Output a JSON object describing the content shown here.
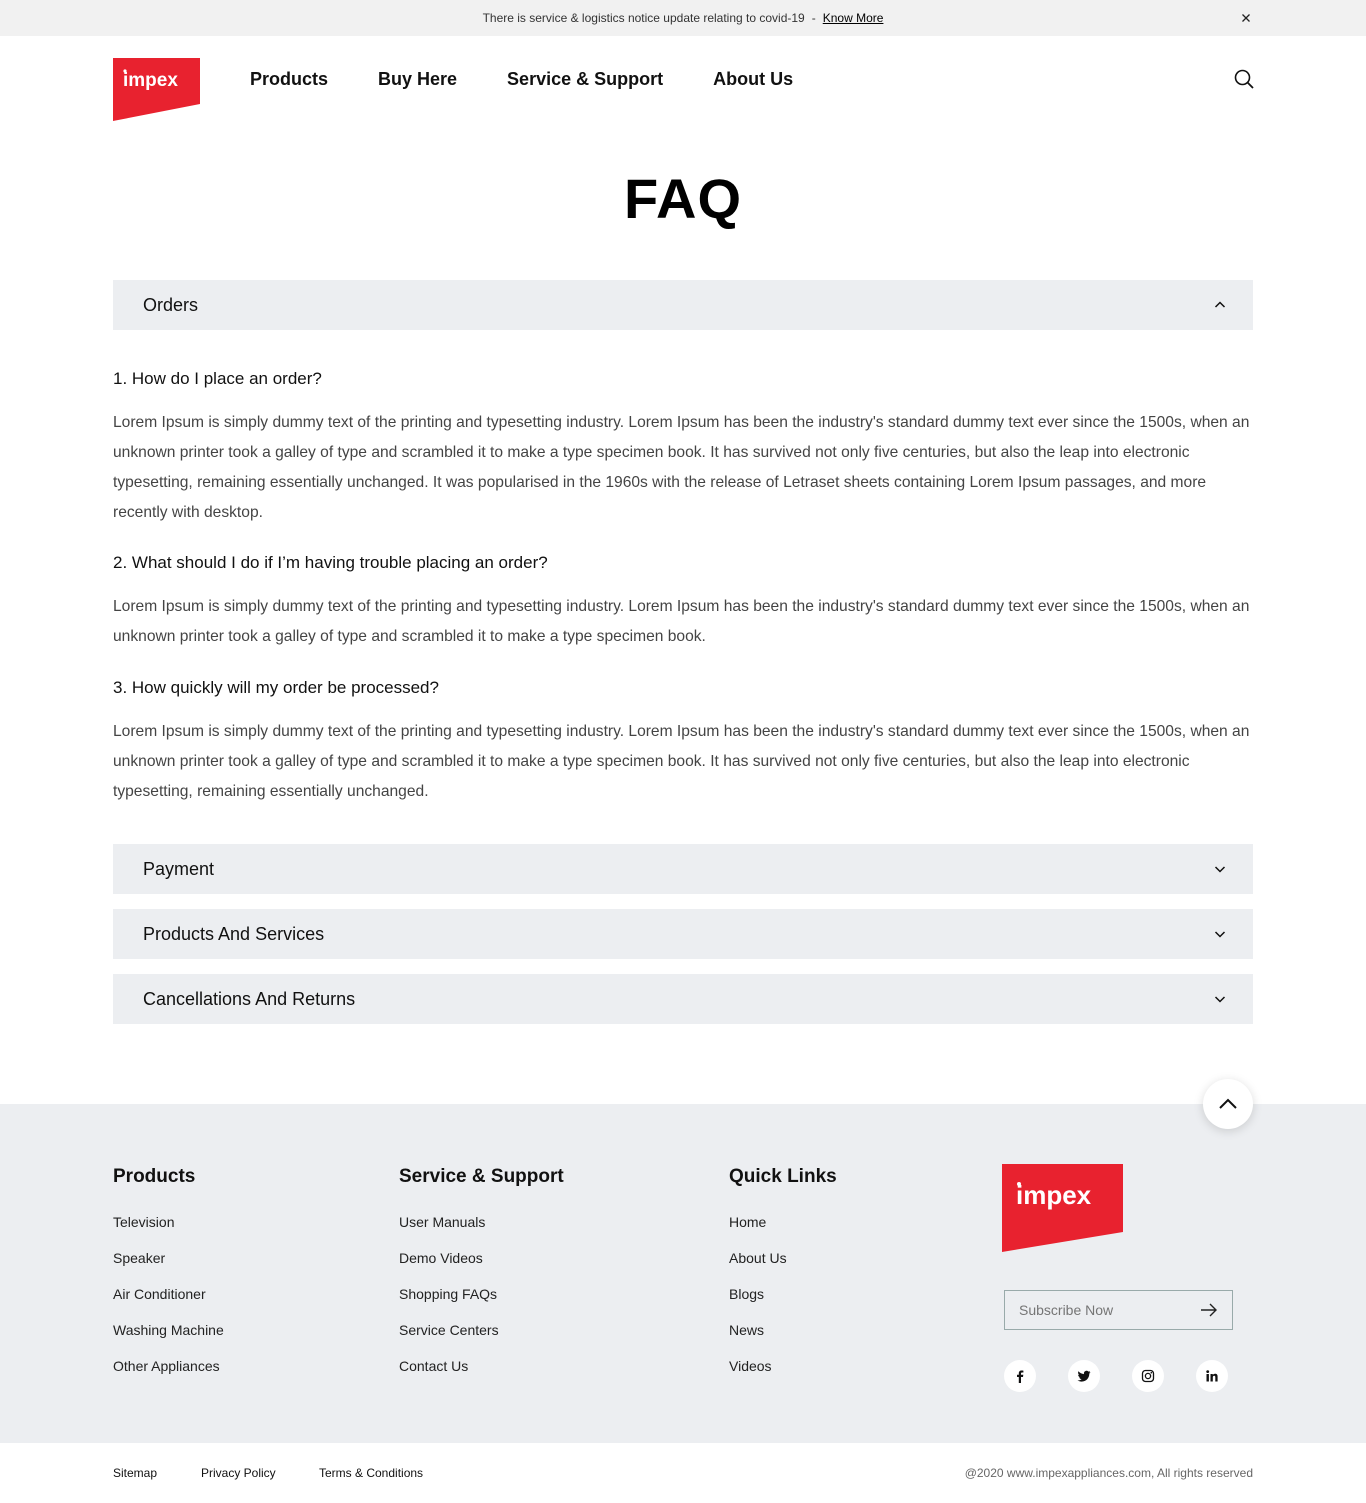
{
  "notice": {
    "text": "There is service & logistics notice update relating to covid-19",
    "separator": "-",
    "link": "Know More",
    "close_icon": "close-icon"
  },
  "header": {
    "logo_text": "impex",
    "nav": [
      "Products",
      "Buy Here",
      "Service & Support",
      "About Us"
    ],
    "search_icon": "search-icon"
  },
  "page": {
    "title": "FAQ"
  },
  "accordion": {
    "open_section": "Orders",
    "items": [
      {
        "q": "1. How do I place an order?",
        "a": "Lorem Ipsum is simply dummy text of the printing and typesetting industry. Lorem Ipsum has been the industry's standard dummy text ever since the 1500s, when an unknown printer took a galley of type and scrambled it to make a type specimen book. It has survived not only five centuries, but also the leap into electronic typesetting, remaining essentially unchanged. It was popularised in the 1960s with the release of Letraset sheets containing Lorem Ipsum passages, and more recently with desktop."
      },
      {
        "q": "2. What should I do if I’m having trouble placing an order?",
        "a": "Lorem Ipsum is simply dummy text of the printing and typesetting industry. Lorem Ipsum has been the industry's standard dummy text ever since the 1500s, when an unknown printer took a galley of type and scrambled it to make a type specimen book."
      },
      {
        "q": "3. How quickly will my order be processed?",
        "a": "Lorem Ipsum is simply dummy text of the printing and typesetting industry. Lorem Ipsum has been the industry's standard dummy text ever since the 1500s, when an unknown printer took a galley of type and scrambled it to make a type specimen book. It has survived not only five centuries, but also the leap into electronic typesetting, remaining essentially unchanged."
      }
    ],
    "collapsed_sections": [
      "Payment",
      "Products And Services",
      "Cancellations And Returns"
    ]
  },
  "footer": {
    "products": {
      "title": "Products",
      "links": [
        "Television",
        "Speaker",
        "Air Conditioner",
        "Washing Machine",
        "Other Appliances"
      ]
    },
    "support": {
      "title": "Service & Support",
      "links": [
        "User Manuals",
        "Demo Videos",
        "Shopping FAQs",
        "Service Centers",
        "Contact Us"
      ]
    },
    "quick": {
      "title": "Quick Links",
      "links": [
        "Home",
        "About Us",
        "Blogs",
        "News",
        "Videos"
      ]
    },
    "logo_text": "impex",
    "subscribe_placeholder": "Subscribe Now",
    "social_icons": [
      "facebook-icon",
      "twitter-icon",
      "instagram-icon",
      "linkedin-icon"
    ]
  },
  "bottom": {
    "links": [
      "Sitemap",
      "Privacy Policy",
      "Terms & Conditions"
    ],
    "copyright": "@2020 www.impexappliances.com, All rights reserved"
  },
  "colors": {
    "brand_red": "#e8222f",
    "panel_gray": "#eceef1"
  }
}
